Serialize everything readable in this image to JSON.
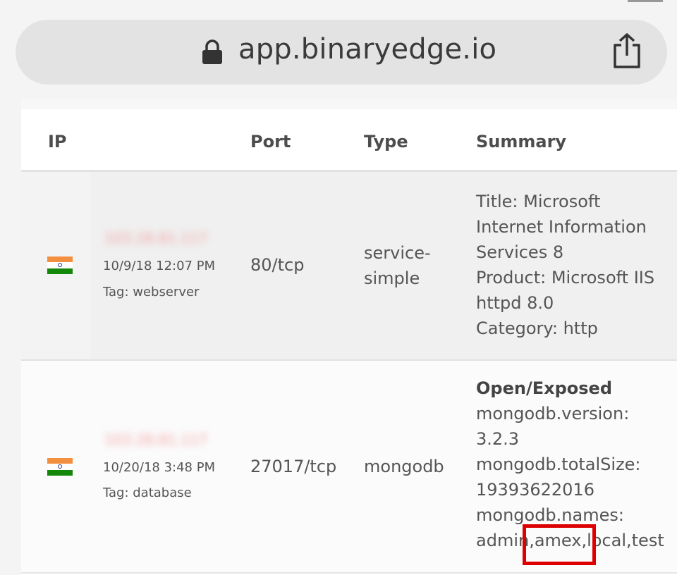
{
  "browser": {
    "url": "app.binaryedge.io"
  },
  "table": {
    "headers": {
      "ip": "IP",
      "port": "Port",
      "type": "Type",
      "summary": "Summary"
    },
    "rows": [
      {
        "country_flag": "india-flag-icon",
        "ip_blurred": "103.28.81.117",
        "date": "10/9/18 12:07 PM",
        "tag": "Tag: webserver",
        "port": "80/tcp",
        "type_line1": "service-",
        "type_line2": "simple",
        "summary": [
          "Title: Microsoft",
          "Internet Information",
          "Services 8",
          "Product: Microsoft IIS",
          "httpd 8.0",
          "Category: http"
        ]
      },
      {
        "country_flag": "india-flag-icon",
        "ip_blurred": "103.28.81.117",
        "date": "10/20/18 3:48 PM",
        "tag": "Tag: database",
        "port": "27017/tcp",
        "type": "mongodb",
        "summary_heading": "Open/Exposed",
        "summary": [
          "mongodb.version:",
          "3.2.3",
          "mongodb.totalSize:",
          "19393622016",
          "mongodb.names:",
          "admin,amex,local,test"
        ]
      }
    ]
  },
  "colors": {
    "highlight": "#dd0000",
    "flag_saffron": "#f3903f",
    "flag_green": "#138808"
  }
}
